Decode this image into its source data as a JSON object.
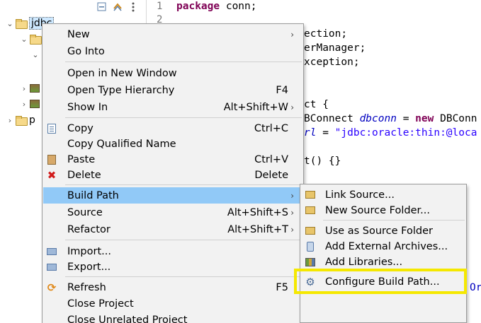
{
  "explorer": {
    "project_label": "jdbc",
    "other_project_label": "p"
  },
  "editor": {
    "line_numbers": [
      "1",
      "2"
    ],
    "lines": {
      "l1_kw": "package",
      "l1_rest": " conn;",
      "l3": "ection;",
      "l4": "erManager;",
      "l5": "xception;",
      "l7": "ct {",
      "l8_type": "BConnect ",
      "l8_field": "dbconn",
      "l8_eq": " = ",
      "l8_new": "new",
      "l8_rest": " DBConn",
      "l9_field": "rl",
      "l9_eq": " = ",
      "l9_str": "\"jdbc:oracle:thin:@loca",
      "l11": "t() {}",
      "l17_field": "Ori"
    }
  },
  "context_menu": {
    "items": [
      {
        "label": "New",
        "accel": "",
        "submenu": true,
        "icon": ""
      },
      {
        "label": "Go Into",
        "accel": "",
        "submenu": false,
        "icon": ""
      },
      {
        "label": "Open in New Window",
        "accel": "",
        "submenu": false,
        "icon": ""
      },
      {
        "label": "Open Type Hierarchy",
        "accel": "F4",
        "submenu": false,
        "icon": ""
      },
      {
        "label": "Show In",
        "accel": "Alt+Shift+W",
        "submenu": true,
        "icon": ""
      },
      {
        "label": "Copy",
        "accel": "Ctrl+C",
        "submenu": false,
        "icon": "copy-icon"
      },
      {
        "label": "Copy Qualified Name",
        "accel": "",
        "submenu": false,
        "icon": ""
      },
      {
        "label": "Paste",
        "accel": "Ctrl+V",
        "submenu": false,
        "icon": "paste-icon"
      },
      {
        "label": "Delete",
        "accel": "Delete",
        "submenu": false,
        "icon": "delete-icon"
      },
      {
        "label": "Build Path",
        "accel": "",
        "submenu": true,
        "icon": ""
      },
      {
        "label": "Source",
        "accel": "Alt+Shift+S",
        "submenu": true,
        "icon": ""
      },
      {
        "label": "Refactor",
        "accel": "Alt+Shift+T",
        "submenu": true,
        "icon": ""
      },
      {
        "label": "Import...",
        "accel": "",
        "submenu": false,
        "icon": "import-icon"
      },
      {
        "label": "Export...",
        "accel": "",
        "submenu": false,
        "icon": "export-icon"
      },
      {
        "label": "Refresh",
        "accel": "F5",
        "submenu": false,
        "icon": "refresh-icon"
      },
      {
        "label": "Close Project",
        "accel": "",
        "submenu": false,
        "icon": ""
      },
      {
        "label": "Close Unrelated Project",
        "accel": "",
        "submenu": false,
        "icon": ""
      }
    ],
    "arrow_glyph": "›"
  },
  "build_path_submenu": {
    "items": [
      {
        "label": "Link Source...",
        "icon": "link-source-icon"
      },
      {
        "label": "New Source Folder...",
        "icon": "new-source-folder-icon"
      },
      {
        "label": "Use as Source Folder",
        "icon": "source-folder-icon"
      },
      {
        "label": "Add External Archives...",
        "icon": "jar-icon"
      },
      {
        "label": "Add Libraries...",
        "icon": "library-icon"
      },
      {
        "label": "Configure Build Path...",
        "icon": "build-path-icon"
      }
    ]
  },
  "colors": {
    "active_item": "#91c9f7",
    "highlight_box": "#f5e800",
    "keyword": "#7f0055",
    "string": "#2a00ff",
    "field": "#0000c0"
  }
}
